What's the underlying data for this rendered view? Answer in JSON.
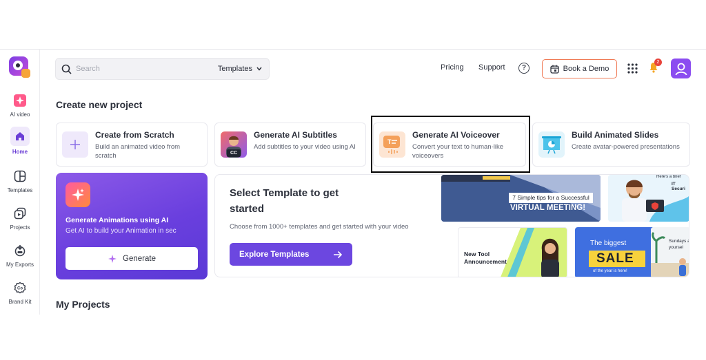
{
  "sidebar": {
    "items": [
      {
        "label": "AI video",
        "icon": "ai-video-icon"
      },
      {
        "label": "Home",
        "icon": "home-icon",
        "active": true
      },
      {
        "label": "Templates",
        "icon": "templates-icon"
      },
      {
        "label": "Projects",
        "icon": "projects-icon"
      },
      {
        "label": "My Exports",
        "icon": "exports-icon"
      },
      {
        "label": "Brand Kit",
        "icon": "brand-kit-icon"
      }
    ]
  },
  "header": {
    "search_placeholder": "Search",
    "search_scope": "Templates",
    "pricing": "Pricing",
    "support": "Support",
    "help": "?",
    "book_demo": "Book a Demo",
    "notification_count": "2"
  },
  "create": {
    "title": "Create new project",
    "cards": [
      {
        "title": "Create from Scratch",
        "desc": "Build an animated video from scratch"
      },
      {
        "title": "Generate AI Subtitles",
        "desc": "Add subtitles to your video using AI",
        "badge": "CC"
      },
      {
        "title": "Generate AI Voiceover",
        "desc": "Convert your text to human-like voiceovers"
      },
      {
        "title": "Build Animated Slides",
        "desc": "Create avatar-powered presentations"
      }
    ]
  },
  "genai": {
    "title": "Generate Animations using AI",
    "desc": "Get AI to build your Animation in sec",
    "button": "Generate"
  },
  "templates": {
    "title": "Select Template to get started",
    "desc": "Choose from 1000+ templates and get started with your video",
    "button": "Explore Templates",
    "tiles": {
      "meeting_caption": "7 Simple tips for a Successful",
      "meeting_title": "VIRTUAL MEETING!",
      "security_top": "Here's a brief",
      "security_label": "IT Securi",
      "announcement": "New Tool Announcement",
      "sale_top": "The biggest",
      "sale": "SALE",
      "sale_bottom": "of the year is here!",
      "sundays": "Sundays a yoursel"
    }
  },
  "projects": {
    "title": "My Projects"
  },
  "colors": {
    "accent": "#6c47e0",
    "demo_border": "#f07a55",
    "badge": "#e8433a"
  }
}
